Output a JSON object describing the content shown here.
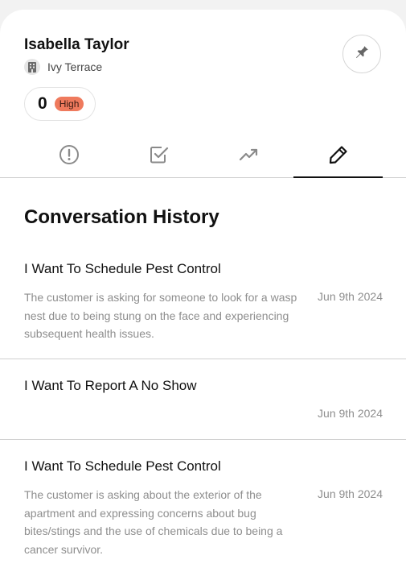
{
  "contact": {
    "name": "Isabella Taylor",
    "location": "Ivy Terrace",
    "location_icon": "building-icon",
    "pin_icon": "pin-icon"
  },
  "score": {
    "value": "0",
    "priority": "High",
    "priority_color": "#ef7a5d"
  },
  "tabs": [
    {
      "icon": "alert-circle-icon",
      "active": false
    },
    {
      "icon": "checkbox-icon",
      "active": false
    },
    {
      "icon": "trending-up-icon",
      "active": false
    },
    {
      "icon": "pencil-icon",
      "active": true
    }
  ],
  "section": {
    "title": "Conversation History"
  },
  "conversations": [
    {
      "title": "I Want To Schedule Pest Control",
      "summary": "The customer is asking for someone to look for a wasp nest due to being stung on the face and experiencing subsequent health issues.",
      "date": "Jun 9th 2024"
    },
    {
      "title": "I Want To Report A No Show",
      "summary": "",
      "date": "Jun 9th 2024"
    },
    {
      "title": "I Want To Schedule Pest Control",
      "summary": "The customer is asking about the exterior of the apartment and expressing concerns about bug bites/stings and the use of chemicals due to being a cancer survivor.",
      "date": "Jun 9th 2024"
    }
  ]
}
